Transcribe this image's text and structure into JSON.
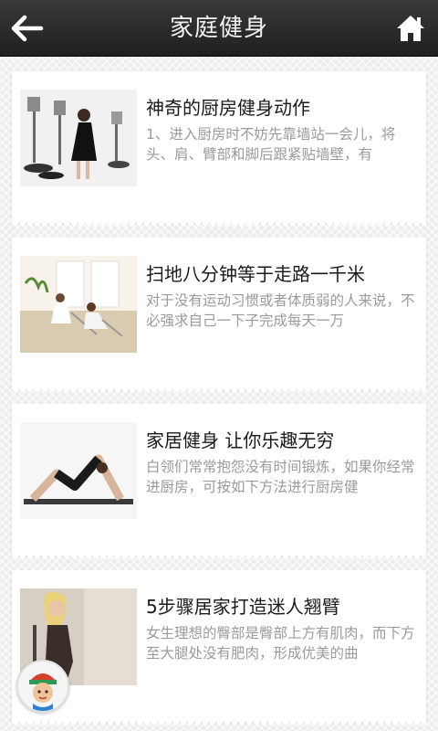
{
  "header": {
    "title": "家庭健身",
    "back_icon": "back-arrow-icon",
    "home_icon": "home-icon"
  },
  "articles": [
    {
      "title": "神奇的厨房健身动作",
      "summary": "1、进入厨房时不妨先靠墙站一会儿，将头、肩、臂部和脚后跟紧贴墙壁，有"
    },
    {
      "title": "扫地八分钟等于走路一千米",
      "summary": "对于没有运动习惯或者体质弱的人来说，不必强求自己一下子完成每天一万"
    },
    {
      "title": "家居健身 让你乐趣无穷",
      "summary": "白领们常常抱怨没有时间锻炼，如果你经常进厨房，可按如下方法进行厨房健"
    },
    {
      "title": "5步骤居家打造迷人翘臂",
      "summary": "女生理想的臀部是臀部上方有肌肉，而下方至大腿处没有肥肉，形成优美的曲"
    }
  ],
  "floating_button": {
    "icon": "chef-avatar-icon"
  },
  "colors": {
    "header": "#2b2b2b",
    "title_text": "#f2f2f2",
    "summary_text": "#9a9a9a"
  }
}
